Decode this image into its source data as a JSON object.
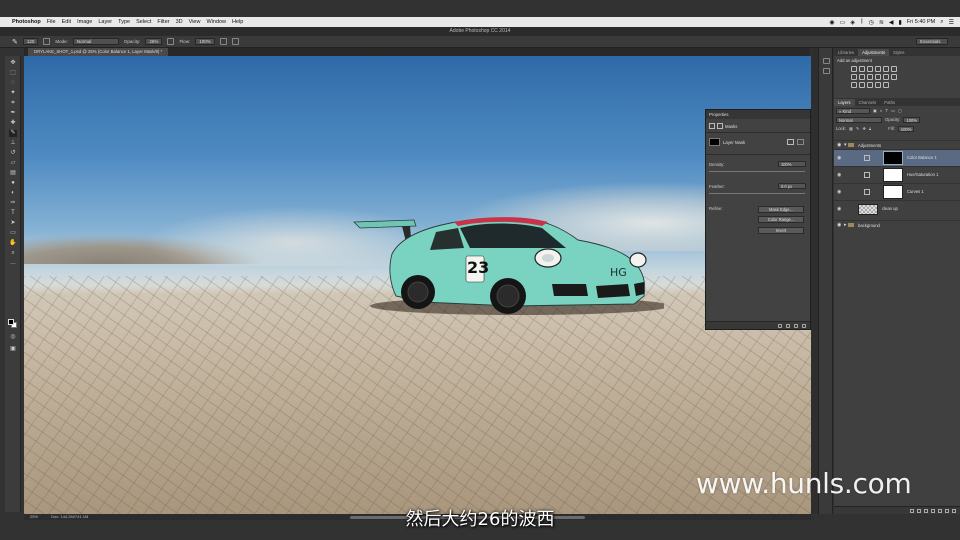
{
  "menubar": {
    "app": "Photoshop",
    "items": [
      "File",
      "Edit",
      "Image",
      "Layer",
      "Type",
      "Select",
      "Filter",
      "3D",
      "View",
      "Window",
      "Help"
    ],
    "clock": "Fri 5:40 PM"
  },
  "window_title": "Adobe Photoshop CC 2014",
  "options": {
    "brush_size": "120",
    "mode_label": "Mode:",
    "mode_value": "Normal",
    "opacity_label": "Opacity:",
    "opacity_value": "26%",
    "flow_label": "Flow:",
    "flow_value": "100%",
    "workspace": "Essentials"
  },
  "document_tab": "DRYLAKE_SHOT_1.psd @ 25% (Color Balance 1, Layer Mask/8) *",
  "properties": {
    "title": "Properties",
    "section": "Masks",
    "layer_mask": "Layer Mask",
    "density_label": "Density:",
    "density_value": "100%",
    "feather_label": "Feather:",
    "feather_value": "0.0 px",
    "refine_label": "Refine:",
    "buttons": [
      "Mask Edge...",
      "Color Range...",
      "Invert"
    ]
  },
  "panels": {
    "top_tabs": [
      "Libraries",
      "Adjustments",
      "Styles"
    ],
    "add_adjustment": "Add an adjustment",
    "layer_tabs": [
      "Layers",
      "Channels",
      "Paths"
    ],
    "kind": "Kind",
    "blend_mode": "Normal",
    "opacity_label": "Opacity:",
    "opacity_value": "100%",
    "lock_label": "Lock:",
    "fill_label": "Fill:",
    "fill_value": "100%",
    "layers": [
      {
        "name": "Adjustments",
        "type": "group"
      },
      {
        "name": "Color Balance 1",
        "type": "adjustment",
        "selected": true
      },
      {
        "name": "Hue/Saturation 1",
        "type": "adjustment"
      },
      {
        "name": "Curves 1",
        "type": "adjustment"
      },
      {
        "name": "clean up",
        "type": "pixel"
      },
      {
        "name": "background",
        "type": "group"
      }
    ]
  },
  "status": {
    "zoom": "25%",
    "doc": "Doc: 144.2M/741.1M"
  },
  "car_number": "23",
  "watermark": "www.hunls.com",
  "subtitle": "然后大约26的波西",
  "colors": {
    "car_body": "#79d3c0",
    "car_roof": "#c83349",
    "sky_top": "#2f6aa8",
    "selected_layer": "#5a6a83"
  }
}
